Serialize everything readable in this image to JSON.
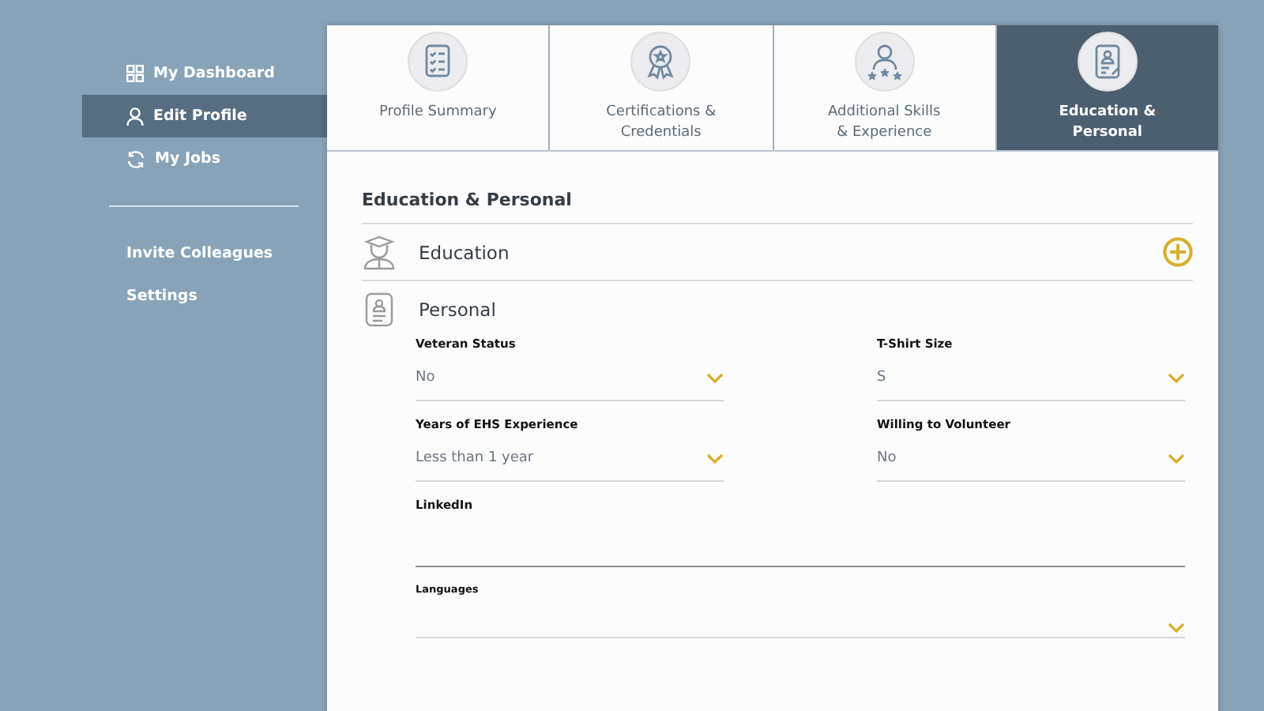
{
  "sidebar": {
    "items": [
      {
        "label": "My Dashboard",
        "selected": false
      },
      {
        "label": "Edit Profile",
        "selected": true
      },
      {
        "label": "My Jobs",
        "selected": false
      }
    ],
    "links": [
      "Invite Colleagues",
      "Settings"
    ]
  },
  "tabs": [
    {
      "label": "Profile Summary",
      "selected": false
    },
    {
      "label": "Certifications & Credentials",
      "selected": false
    },
    {
      "label": "Additional Skills & Experience",
      "selected": false
    },
    {
      "label": "Education & Personal",
      "selected": true
    }
  ],
  "heading": "Education & Personal",
  "sections": [
    {
      "title": "Education",
      "expanded": false
    },
    {
      "title": "Personal",
      "expanded": true
    }
  ],
  "field_rows": [
    [
      {
        "label": "Veteran Status",
        "kind": "select",
        "value": "No"
      },
      {
        "label": "T-Shirt Size",
        "kind": "select",
        "value": "S"
      }
    ],
    [
      {
        "label": "Years of EHS Experience",
        "kind": "select",
        "value": "Less than 1 year"
      },
      {
        "label": "Willing to Volunteer",
        "kind": "select",
        "value": "No"
      }
    ],
    [
      {
        "label": "LinkedIn",
        "kind": "text"
      }
    ],
    [
      {
        "label": "Languages",
        "kind": "select"
      }
    ]
  ]
}
